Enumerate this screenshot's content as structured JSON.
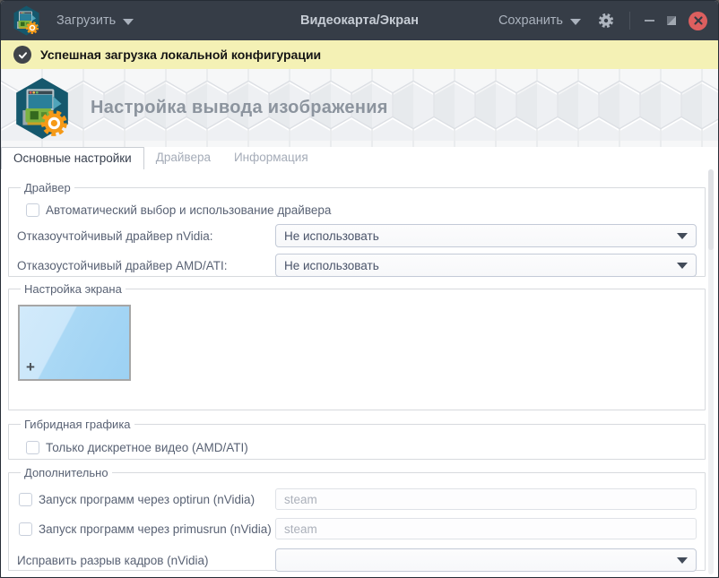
{
  "titlebar": {
    "load_label": "Загрузить",
    "title": "Видеокарта/Экран",
    "save_label": "Сохранить"
  },
  "notification": {
    "message": "Успешная загрузка локальной конфигурации"
  },
  "header": {
    "title": "Настройка вывода изображения"
  },
  "tabs": [
    {
      "label": "Основные настройки",
      "active": true
    },
    {
      "label": "Драйвера",
      "active": false
    },
    {
      "label": "Информация",
      "active": false
    }
  ],
  "driver_section": {
    "legend": "Драйвер",
    "auto_select_label": "Автоматический выбор и использование драйвера",
    "auto_select_checked": false,
    "nvidia_failsafe_label": "Отказоучтойчивый драйвер nVidia:",
    "nvidia_failsafe_value": "Не использовать",
    "amd_failsafe_label": "Отказоустойчивый драйвер AMD/ATI:",
    "amd_failsafe_value": "Не использовать"
  },
  "screen_section": {
    "legend": "Настройка экрана",
    "add_screen_symbol": "+"
  },
  "hybrid_section": {
    "legend": "Гибридная графика",
    "discrete_only_label": "Только дискретное видео (AMD/ATI)",
    "discrete_only_checked": false
  },
  "extra_section": {
    "legend": "Дополнительно",
    "optirun_label": "Запуск программ через optirun (nVidia)",
    "optirun_checked": false,
    "optirun_value": "",
    "optirun_placeholder": "steam",
    "primusrun_label": "Запуск программ через primusrun (nVidia)",
    "primusrun_checked": false,
    "primusrun_value": "",
    "primusrun_placeholder": "steam",
    "tearfix_label": "Исправить разрыв кадров (nVidia)",
    "tearfix_value": ""
  },
  "colors": {
    "titlebar_bg": "#363d47",
    "notification_bg": "#f4f1b5",
    "close_button": "#dd5f5f",
    "accent_orange": "#f59a18",
    "hex_icon_teal": "#15586d",
    "screen_preview_blue": "#aad8f5"
  }
}
